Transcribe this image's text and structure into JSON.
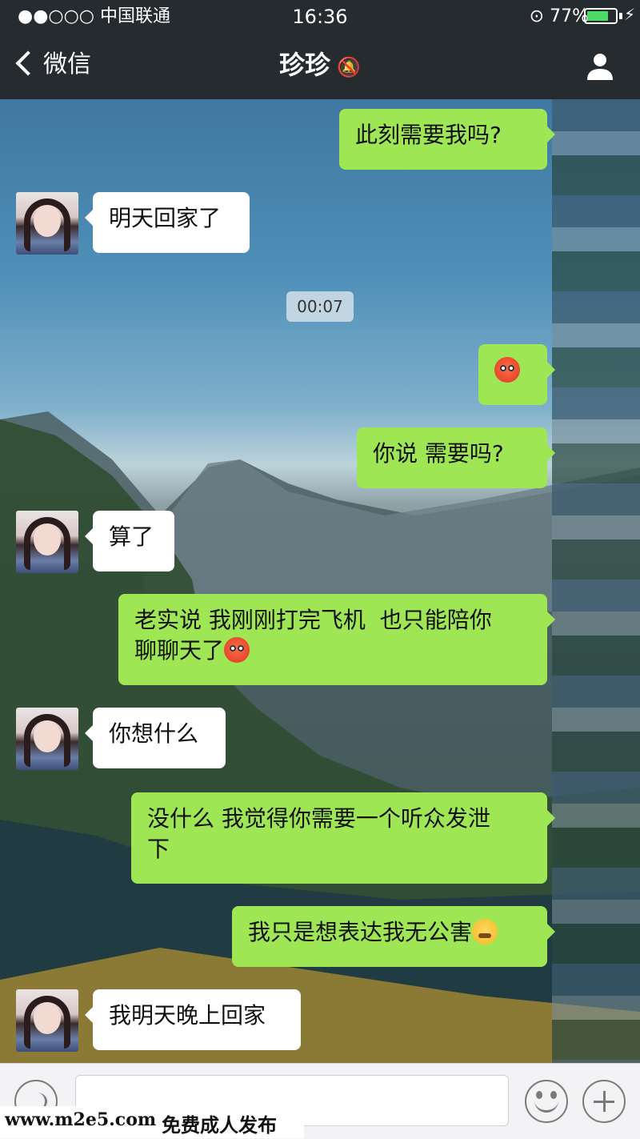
{
  "status_bar": {
    "carrier": "●●○○○ 中国联通",
    "time": "16:36",
    "battery": "77%",
    "battery_level": 0.77,
    "lock_icon": "orientation-lock-icon",
    "wifi_icon": "wifi-icon",
    "charging_icon": "charging-bolt-icon"
  },
  "nav": {
    "back_label": "微信",
    "title": "珍珍",
    "mute_icon": "mute-notification-icon",
    "profile_icon": "person-icon"
  },
  "chat": {
    "timestamp": "00:07",
    "messages": [
      {
        "side": "out",
        "text": "此刻需要我吗?"
      },
      {
        "side": "in",
        "text": "明天回家了"
      },
      {
        "side": "out",
        "text": "",
        "emoji": "flushed-face-emoji"
      },
      {
        "side": "out",
        "text": "你说 需要吗?"
      },
      {
        "side": "in",
        "text": "算了"
      },
      {
        "side": "out",
        "text": "老实说 我刚刚打完飞机  也只能陪你\n聊聊天了",
        "emoji": "flushed-face-emoji"
      },
      {
        "side": "in",
        "text": "你想什么"
      },
      {
        "side": "out",
        "text": "没什么 我觉得你需要一个听众发泄\n下"
      },
      {
        "side": "out",
        "text": "我只是想表达我无公害",
        "emoji": "crying-face-emoji"
      },
      {
        "side": "in",
        "text": "我明天晚上回家"
      }
    ]
  },
  "input_bar": {
    "voice_icon": "voice-icon",
    "emoji_icon": "smiley-icon",
    "plus_icon": "plus-icon"
  },
  "watermark": {
    "url": "www.m2e5.com",
    "text": "免费成人发布"
  },
  "colors": {
    "nav_bg": "#262b2f",
    "bubble_out": "#9ee654",
    "bubble_in": "#ffffff",
    "battery": "#4cd964"
  }
}
